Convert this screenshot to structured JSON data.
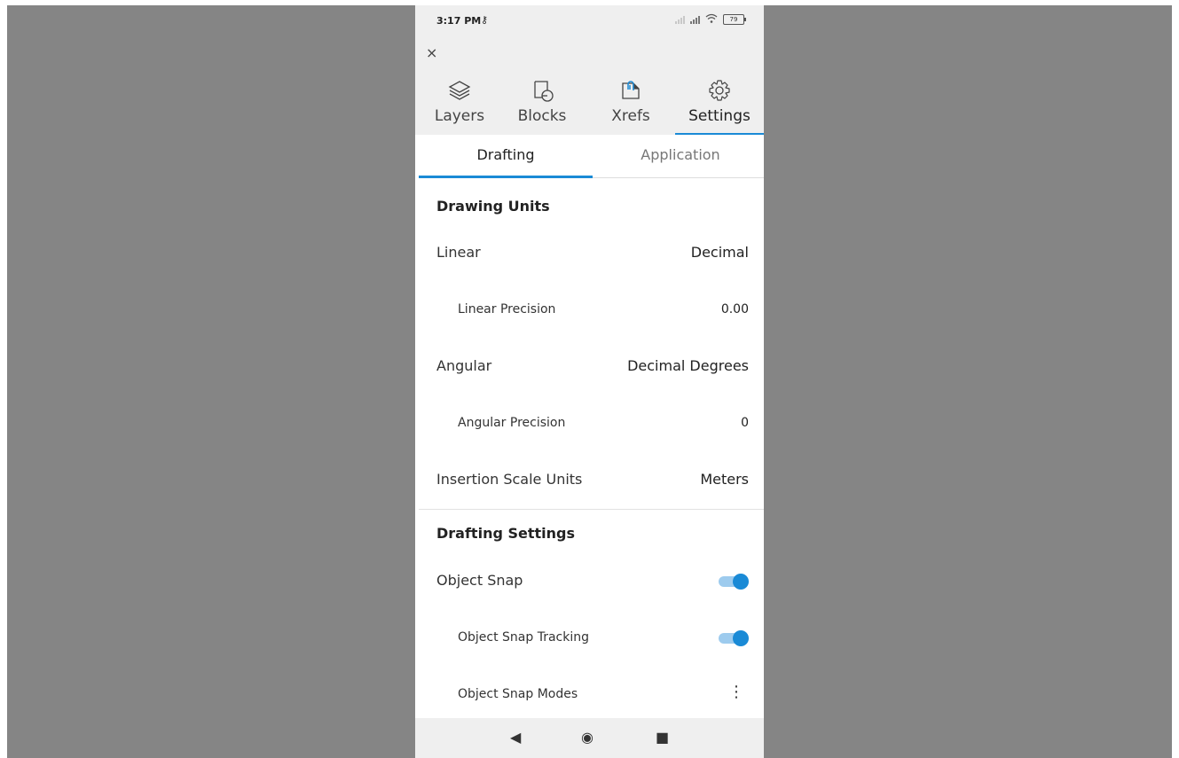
{
  "status_bar": {
    "time": "3:17 PM",
    "key_icon": "key-icon",
    "battery": "79"
  },
  "header": {
    "close_label": "×",
    "tabs": [
      {
        "label": "Layers",
        "icon": "layers-icon"
      },
      {
        "label": "Blocks",
        "icon": "blocks-icon"
      },
      {
        "label": "Xrefs",
        "icon": "xrefs-icon"
      },
      {
        "label": "Settings",
        "icon": "gear-icon",
        "active": true
      }
    ]
  },
  "subtabs": [
    {
      "label": "Drafting",
      "active": true
    },
    {
      "label": "Application"
    }
  ],
  "drawing_units": {
    "title": "Drawing Units",
    "rows": [
      {
        "label": "Linear",
        "value": "Decimal"
      },
      {
        "label": "Linear Precision",
        "value": "0.00"
      },
      {
        "label": "Angular",
        "value": "Decimal Degrees"
      },
      {
        "label": "Angular Precision",
        "value": "0"
      },
      {
        "label": "Insertion Scale Units",
        "value": "Meters"
      }
    ]
  },
  "drafting_settings": {
    "title": "Drafting Settings",
    "object_snap": {
      "label": "Object Snap",
      "on": true
    },
    "object_snap_tracking": {
      "label": "Object Snap Tracking",
      "on": true
    },
    "object_snap_modes": {
      "label": "Object Snap Modes"
    }
  },
  "nav": {
    "back": "◀",
    "home": "◉",
    "recents": "■"
  },
  "colors": {
    "accent": "#1a8ad6",
    "backdrop": "#858585",
    "bar": "#efefef"
  }
}
